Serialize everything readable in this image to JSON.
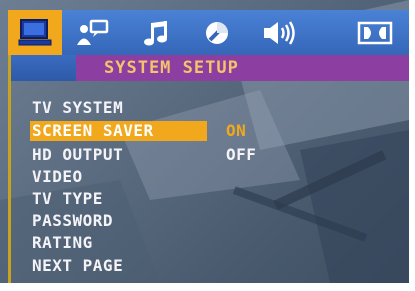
{
  "tabs": [
    {
      "icon": "monitor-icon",
      "active": true
    },
    {
      "icon": "user-chat-icon",
      "active": false
    },
    {
      "icon": "music-note-icon",
      "active": false
    },
    {
      "icon": "circle-icon",
      "active": false
    },
    {
      "icon": "speaker-icon",
      "active": false
    },
    {
      "icon": "dolby-icon",
      "active": false
    }
  ],
  "header": {
    "title": "SYSTEM SETUP"
  },
  "menu": {
    "items": [
      {
        "label": "TV SYSTEM"
      },
      {
        "label": "SCREEN SAVER"
      },
      {
        "label": "HD OUTPUT"
      },
      {
        "label": "VIDEO"
      },
      {
        "label": "TV TYPE"
      },
      {
        "label": "PASSWORD"
      },
      {
        "label": "RATING"
      },
      {
        "label": "NEXT PAGE"
      }
    ],
    "selected_index": 1
  },
  "options": [
    {
      "label": "ON",
      "color": "#f2a81c"
    },
    {
      "label": "OFF",
      "color": "#f4f4f8"
    }
  ],
  "colors": {
    "accent": "#f2a81c",
    "tabbar": "#3a6cc2",
    "titlebar": "#8c3fa0",
    "title_text": "#f6c26b"
  }
}
